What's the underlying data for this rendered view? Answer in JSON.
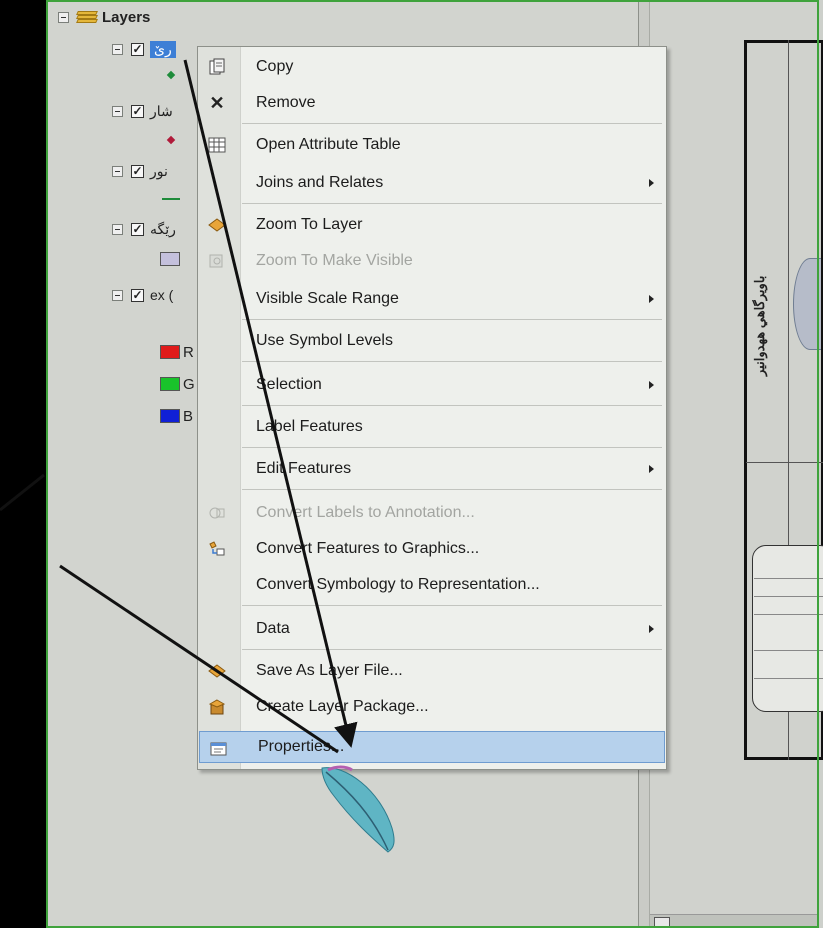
{
  "toc": {
    "root_label": "Layers",
    "layers": [
      {
        "name": "رێ",
        "checked": true,
        "selected": true
      },
      {
        "name": "شار",
        "checked": true
      },
      {
        "name": "نور",
        "checked": true
      },
      {
        "name": "رێگە",
        "checked": true
      },
      {
        "name": "ex (",
        "checked": true
      }
    ],
    "legend_partial": [
      "R",
      "G",
      "B"
    ],
    "check_glyph": "✓"
  },
  "context_menu": {
    "items": [
      {
        "label": "Copy",
        "icon": "copy-icon"
      },
      {
        "label": "Remove",
        "icon": "remove-icon"
      },
      {
        "label": "Open Attribute Table",
        "icon": "table-icon"
      },
      {
        "label": "Joins and Relates",
        "submenu": true
      },
      {
        "label": "Zoom To Layer",
        "icon": "zoom-layer-icon"
      },
      {
        "label": "Zoom To Make Visible",
        "icon": "zoom-visible-icon",
        "disabled": true
      },
      {
        "label": "Visible Scale Range",
        "submenu": true
      },
      {
        "label": "Use Symbol Levels"
      },
      {
        "label": "Selection",
        "submenu": true
      },
      {
        "label": "Label Features"
      },
      {
        "label": "Edit Features",
        "submenu": true
      },
      {
        "label": "Convert Labels to Annotation...",
        "icon": "convert-labels-icon",
        "disabled": true
      },
      {
        "label": "Convert Features to Graphics...",
        "icon": "convert-graphics-icon"
      },
      {
        "label": "Convert Symbology to Representation..."
      },
      {
        "label": "Data",
        "submenu": true
      },
      {
        "label": "Save As Layer File...",
        "icon": "layer-file-icon"
      },
      {
        "label": "Create Layer Package...",
        "icon": "layer-package-icon"
      },
      {
        "label": "Properties...",
        "icon": "properties-icon",
        "highlighted": true
      }
    ]
  },
  "map_layout": {
    "title_text": "باويرگاهي ههدوانير"
  },
  "colors": {
    "selection_blue": "#3d7fd6",
    "highlight_fill": "#b6d1ec",
    "frame_green": "#3fa33c",
    "legend_red": "#e01b1b",
    "legend_green": "#19c32b",
    "legend_blue": "#1020d6",
    "point_green": "#1e8b3a",
    "point_red": "#b01a3a",
    "polygon_lilac": "#c4c0dc"
  }
}
